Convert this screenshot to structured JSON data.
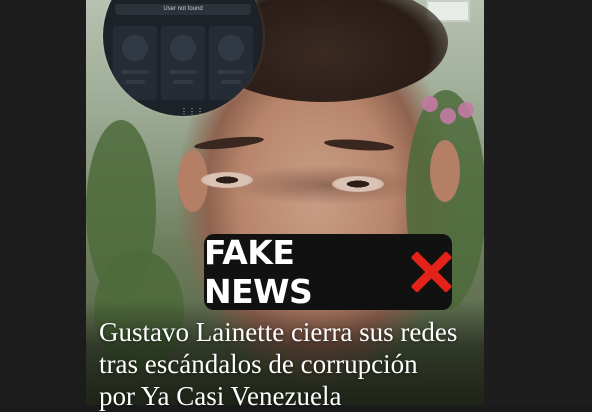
{
  "overlay": {
    "search_status": "User not found",
    "menu_glyph": "⋮⋮⋮"
  },
  "badge": {
    "text": "FAKE NEWS",
    "icon": "cross-mark-icon",
    "icon_color": "#e2231a"
  },
  "headline": {
    "lines": [
      "Gustavo Lainette cierra sus redes",
      "tras escándalos de corrupción",
      "por Ya Casi Venezuela"
    ]
  }
}
